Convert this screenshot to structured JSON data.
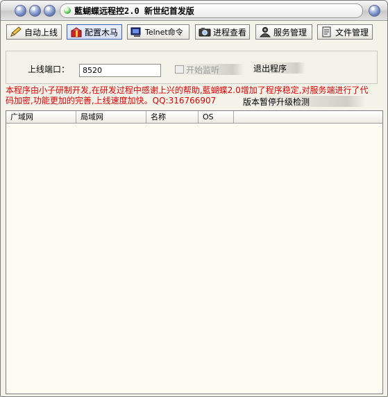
{
  "window": {
    "title": "藍蝴蝶远程控2.0  新世纪首发版"
  },
  "toolbar": {
    "buttons": [
      {
        "label": "自动上线",
        "icon": "pencil-icon"
      },
      {
        "label": "配置木马",
        "icon": "gift-box-icon"
      },
      {
        "label": "Telnet命令",
        "icon": "terminal-icon"
      },
      {
        "label": "进程查看",
        "icon": "camera-icon"
      },
      {
        "label": "服务管理",
        "icon": "user-service-icon"
      },
      {
        "label": "文件管理",
        "icon": "file-tools-icon"
      }
    ]
  },
  "controls": {
    "port_label": "上线端口：",
    "port_value": "8520",
    "start_listen_label": "开始监听",
    "exit_label": "退出程序",
    "upgrade_check_label": "版本暂停升级检测"
  },
  "notice": {
    "text_line1": "本程序由小子研制开发,在研发过程中感谢上兴的帮助,藍蝴蝶2.0增加了程序稳定,对服务端进行了代",
    "text_line2": "码加密,功能更加的完善,上线速度加快。QQ:316766907"
  },
  "listview": {
    "columns": [
      "广域网",
      "局域网",
      "名称",
      "OS"
    ]
  },
  "colors": {
    "notice": "#e00000",
    "list_bg": "#fdfcf2",
    "window_bg": "#f3f3ea"
  }
}
